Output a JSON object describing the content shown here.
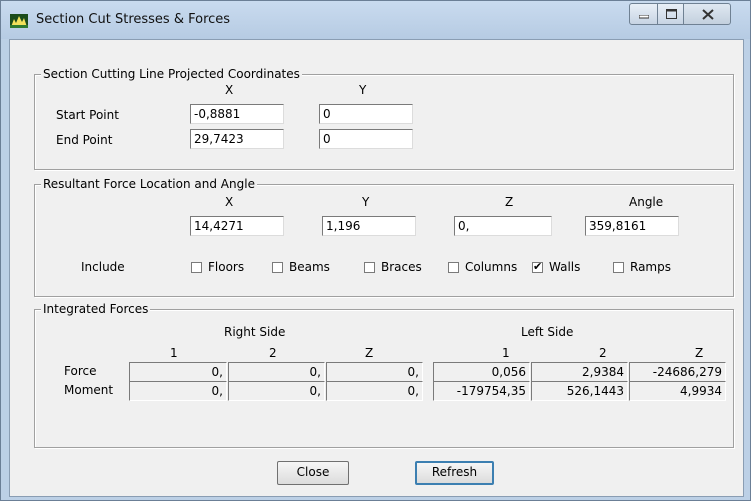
{
  "window": {
    "title": "Section Cut Stresses & Forces",
    "controls": [
      "minimize",
      "maximize",
      "close"
    ]
  },
  "section_line": {
    "group_title": "Section Cutting Line Projected Coordinates",
    "col_x": "X",
    "col_y": "Y",
    "start_label": "Start Point",
    "end_label": "End Point",
    "start_x": "-0,8881",
    "start_y": "0",
    "end_x": "29,7423",
    "end_y": "0"
  },
  "resultant": {
    "group_title": "Resultant Force Location and Angle",
    "col_x": "X",
    "col_y": "Y",
    "col_z": "Z",
    "col_angle": "Angle",
    "x": "14,4271",
    "y": "1,196",
    "z": "0,",
    "angle": "359,8161",
    "include_label": "Include",
    "include": [
      {
        "label": "Floors",
        "checked": false
      },
      {
        "label": "Beams",
        "checked": false
      },
      {
        "label": "Braces",
        "checked": false
      },
      {
        "label": "Columns",
        "checked": false
      },
      {
        "label": "Walls",
        "checked": true
      },
      {
        "label": "Ramps",
        "checked": false
      }
    ]
  },
  "integrated": {
    "group_title": "Integrated Forces",
    "right_side": "Right Side",
    "left_side": "Left Side",
    "columns": [
      "1",
      "2",
      "Z",
      "1",
      "2",
      "Z"
    ],
    "rows": [
      {
        "label": "Force",
        "values": [
          "0,",
          "0,",
          "0,",
          "0,056",
          "2,9384",
          "-24686,279"
        ]
      },
      {
        "label": "Moment",
        "values": [
          "0,",
          "0,",
          "0,",
          "-179754,35",
          "526,1443",
          "4,9934"
        ]
      }
    ]
  },
  "buttons": {
    "close": "Close",
    "refresh": "Refresh"
  }
}
